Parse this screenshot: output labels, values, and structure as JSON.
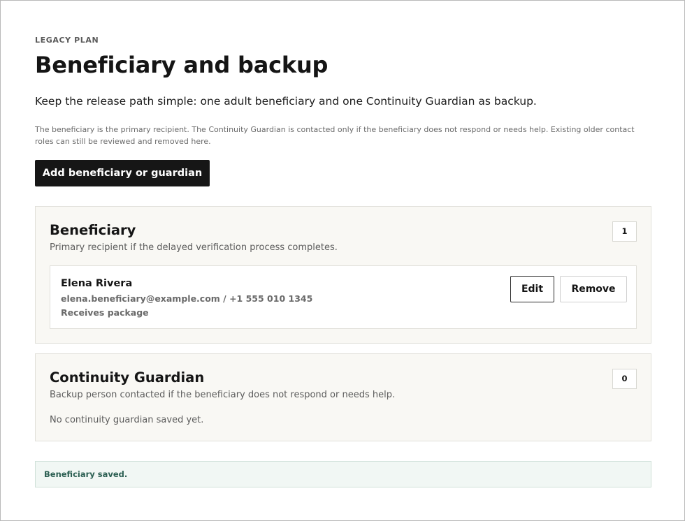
{
  "header": {
    "eyebrow": "LEGACY PLAN",
    "title": "Beneficiary and backup",
    "lead": "Keep the release path simple: one adult beneficiary and one Continuity Guardian as backup.",
    "note": "The beneficiary is the primary recipient. The Continuity Guardian is contacted only if the beneficiary does not respond or needs help. Existing older contact roles can still be reviewed and removed here."
  },
  "actions": {
    "add_label": "Add beneficiary or guardian"
  },
  "beneficiary": {
    "title": "Beneficiary",
    "description": "Primary recipient if the delayed verification process completes.",
    "count": "1",
    "people": [
      {
        "name": "Elena Rivera",
        "contact": "elena.beneficiary@example.com / +1 555 010 1345",
        "role": "Receives package",
        "edit_label": "Edit",
        "remove_label": "Remove"
      }
    ]
  },
  "guardian": {
    "title": "Continuity Guardian",
    "description": "Backup person contacted if the beneficiary does not respond or needs help.",
    "count": "0",
    "empty": "No continuity guardian saved yet."
  },
  "status": {
    "message": "Beneficiary saved."
  }
}
